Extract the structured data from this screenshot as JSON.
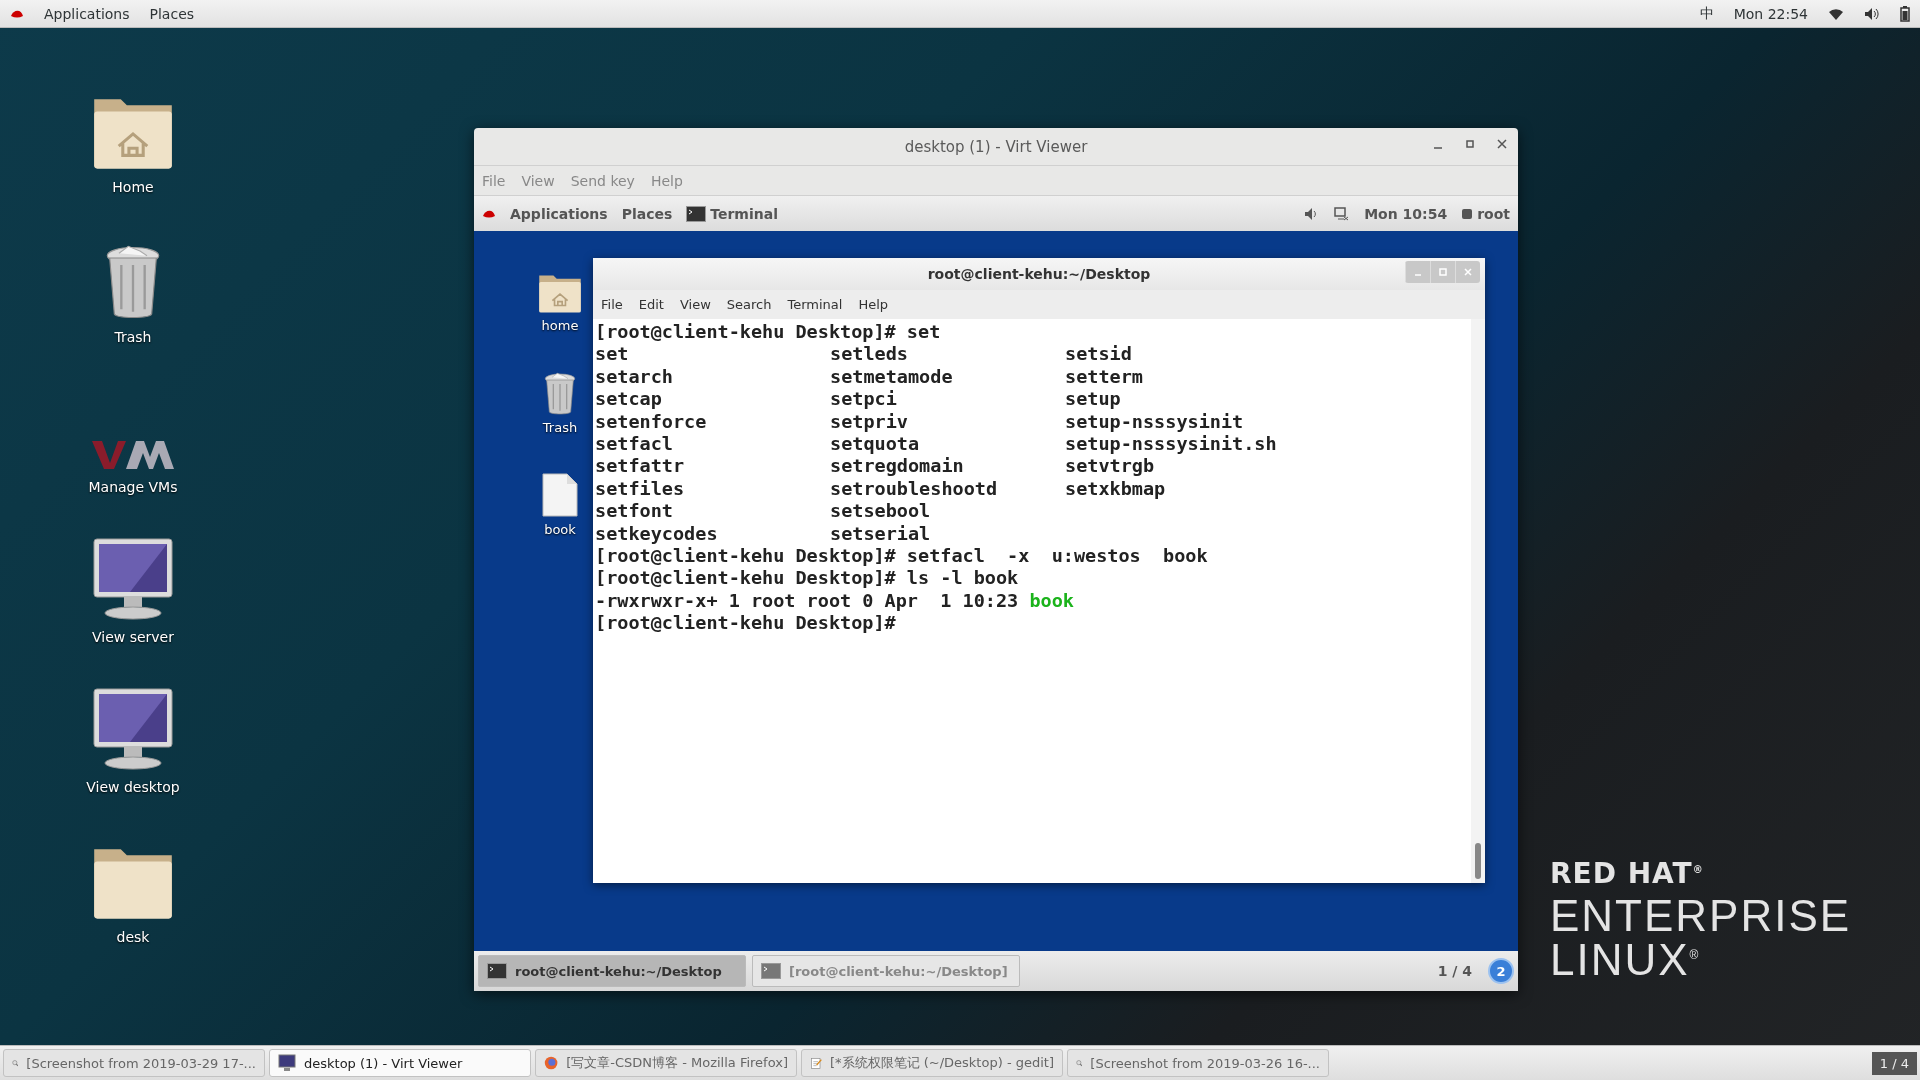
{
  "top_bar": {
    "menus": [
      "Applications",
      "Places"
    ],
    "input_method": "中",
    "clock": "Mon 22:54"
  },
  "desktop_icons": [
    {
      "label": "Home",
      "kind": "home"
    },
    {
      "label": "Trash",
      "kind": "trash"
    },
    {
      "label": "Manage VMs",
      "kind": "vm"
    },
    {
      "label": "View server",
      "kind": "monitor"
    },
    {
      "label": "View desktop",
      "kind": "monitor"
    },
    {
      "label": "desk",
      "kind": "folder"
    }
  ],
  "viewer": {
    "title": "desktop (1) - Virt Viewer",
    "menu": [
      "File",
      "View",
      "Send key",
      "Help"
    ],
    "guest_panel": {
      "menus": [
        "Applications",
        "Places"
      ],
      "task": "Terminal",
      "clock": "Mon 10:54",
      "user": "root"
    },
    "guest_icons": [
      {
        "label": "home",
        "kind": "home"
      },
      {
        "label": "Trash",
        "kind": "trash"
      },
      {
        "label": "book",
        "kind": "file"
      }
    ],
    "terminal": {
      "title": "root@client-kehu:~/Desktop",
      "menu": [
        "File",
        "Edit",
        "View",
        "Search",
        "Terminal",
        "Help"
      ],
      "lines": [
        {
          "kind": "text",
          "text": "[root@client-kehu Desktop]# set"
        },
        {
          "kind": "columns",
          "cells": [
            "set",
            "setleds",
            "setsid"
          ]
        },
        {
          "kind": "columns",
          "cells": [
            "setarch",
            "setmetamode",
            "setterm"
          ]
        },
        {
          "kind": "columns",
          "cells": [
            "setcap",
            "setpci",
            "setup"
          ]
        },
        {
          "kind": "columns",
          "cells": [
            "setenforce",
            "setpriv",
            "setup-nsssysinit"
          ]
        },
        {
          "kind": "columns",
          "cells": [
            "setfacl",
            "setquota",
            "setup-nsssysinit.sh"
          ]
        },
        {
          "kind": "columns",
          "cells": [
            "setfattr",
            "setregdomain",
            "setvtrgb"
          ]
        },
        {
          "kind": "columns",
          "cells": [
            "setfiles",
            "setroubleshootd",
            "setxkbmap"
          ]
        },
        {
          "kind": "columns",
          "cells": [
            "setfont",
            "setsebool"
          ]
        },
        {
          "kind": "columns",
          "cells": [
            "setkeycodes",
            "setserial"
          ]
        },
        {
          "kind": "text",
          "text": "[root@client-kehu Desktop]# setfacl  -x  u:westos  book"
        },
        {
          "kind": "text",
          "text": "[root@client-kehu Desktop]# ls -l book"
        },
        {
          "kind": "listing",
          "text": "-rwxrwxr-x+ 1 root root 0 Apr  1 10:23 ",
          "file": "book"
        },
        {
          "kind": "text",
          "text": "[root@client-kehu Desktop]#"
        }
      ]
    },
    "guest_tasks": [
      {
        "label": "root@client-kehu:~/Desktop",
        "selected": true
      },
      {
        "label": "[root@client-kehu:~/Desktop]",
        "selected": false
      }
    ],
    "guest_workspace": "1 / 4",
    "guest_badge": "2"
  },
  "logo": {
    "line_1": "RED HAT$^{®}$",
    "line_2": "ENTERPRISE",
    "line_3": "LINUX$^{®}$"
  },
  "taskbar": {
    "items": [
      {
        "label": "[Screenshot from 2019-03-29 17-...",
        "kind": "screenshot",
        "selected": false
      },
      {
        "label": "desktop (1) - Virt Viewer",
        "kind": "viewer",
        "selected": true
      },
      {
        "label": "[写文章-CSDN博客 - Mozilla Firefox]",
        "kind": "browser",
        "selected": false
      },
      {
        "label": "[*系统权限笔记 (~/Desktop) - gedit]",
        "kind": "editor",
        "selected": false
      },
      {
        "label": "[Screenshot from 2019-03-26 16-...",
        "kind": "screenshot",
        "selected": false
      }
    ],
    "workspace": "1 / 4"
  }
}
